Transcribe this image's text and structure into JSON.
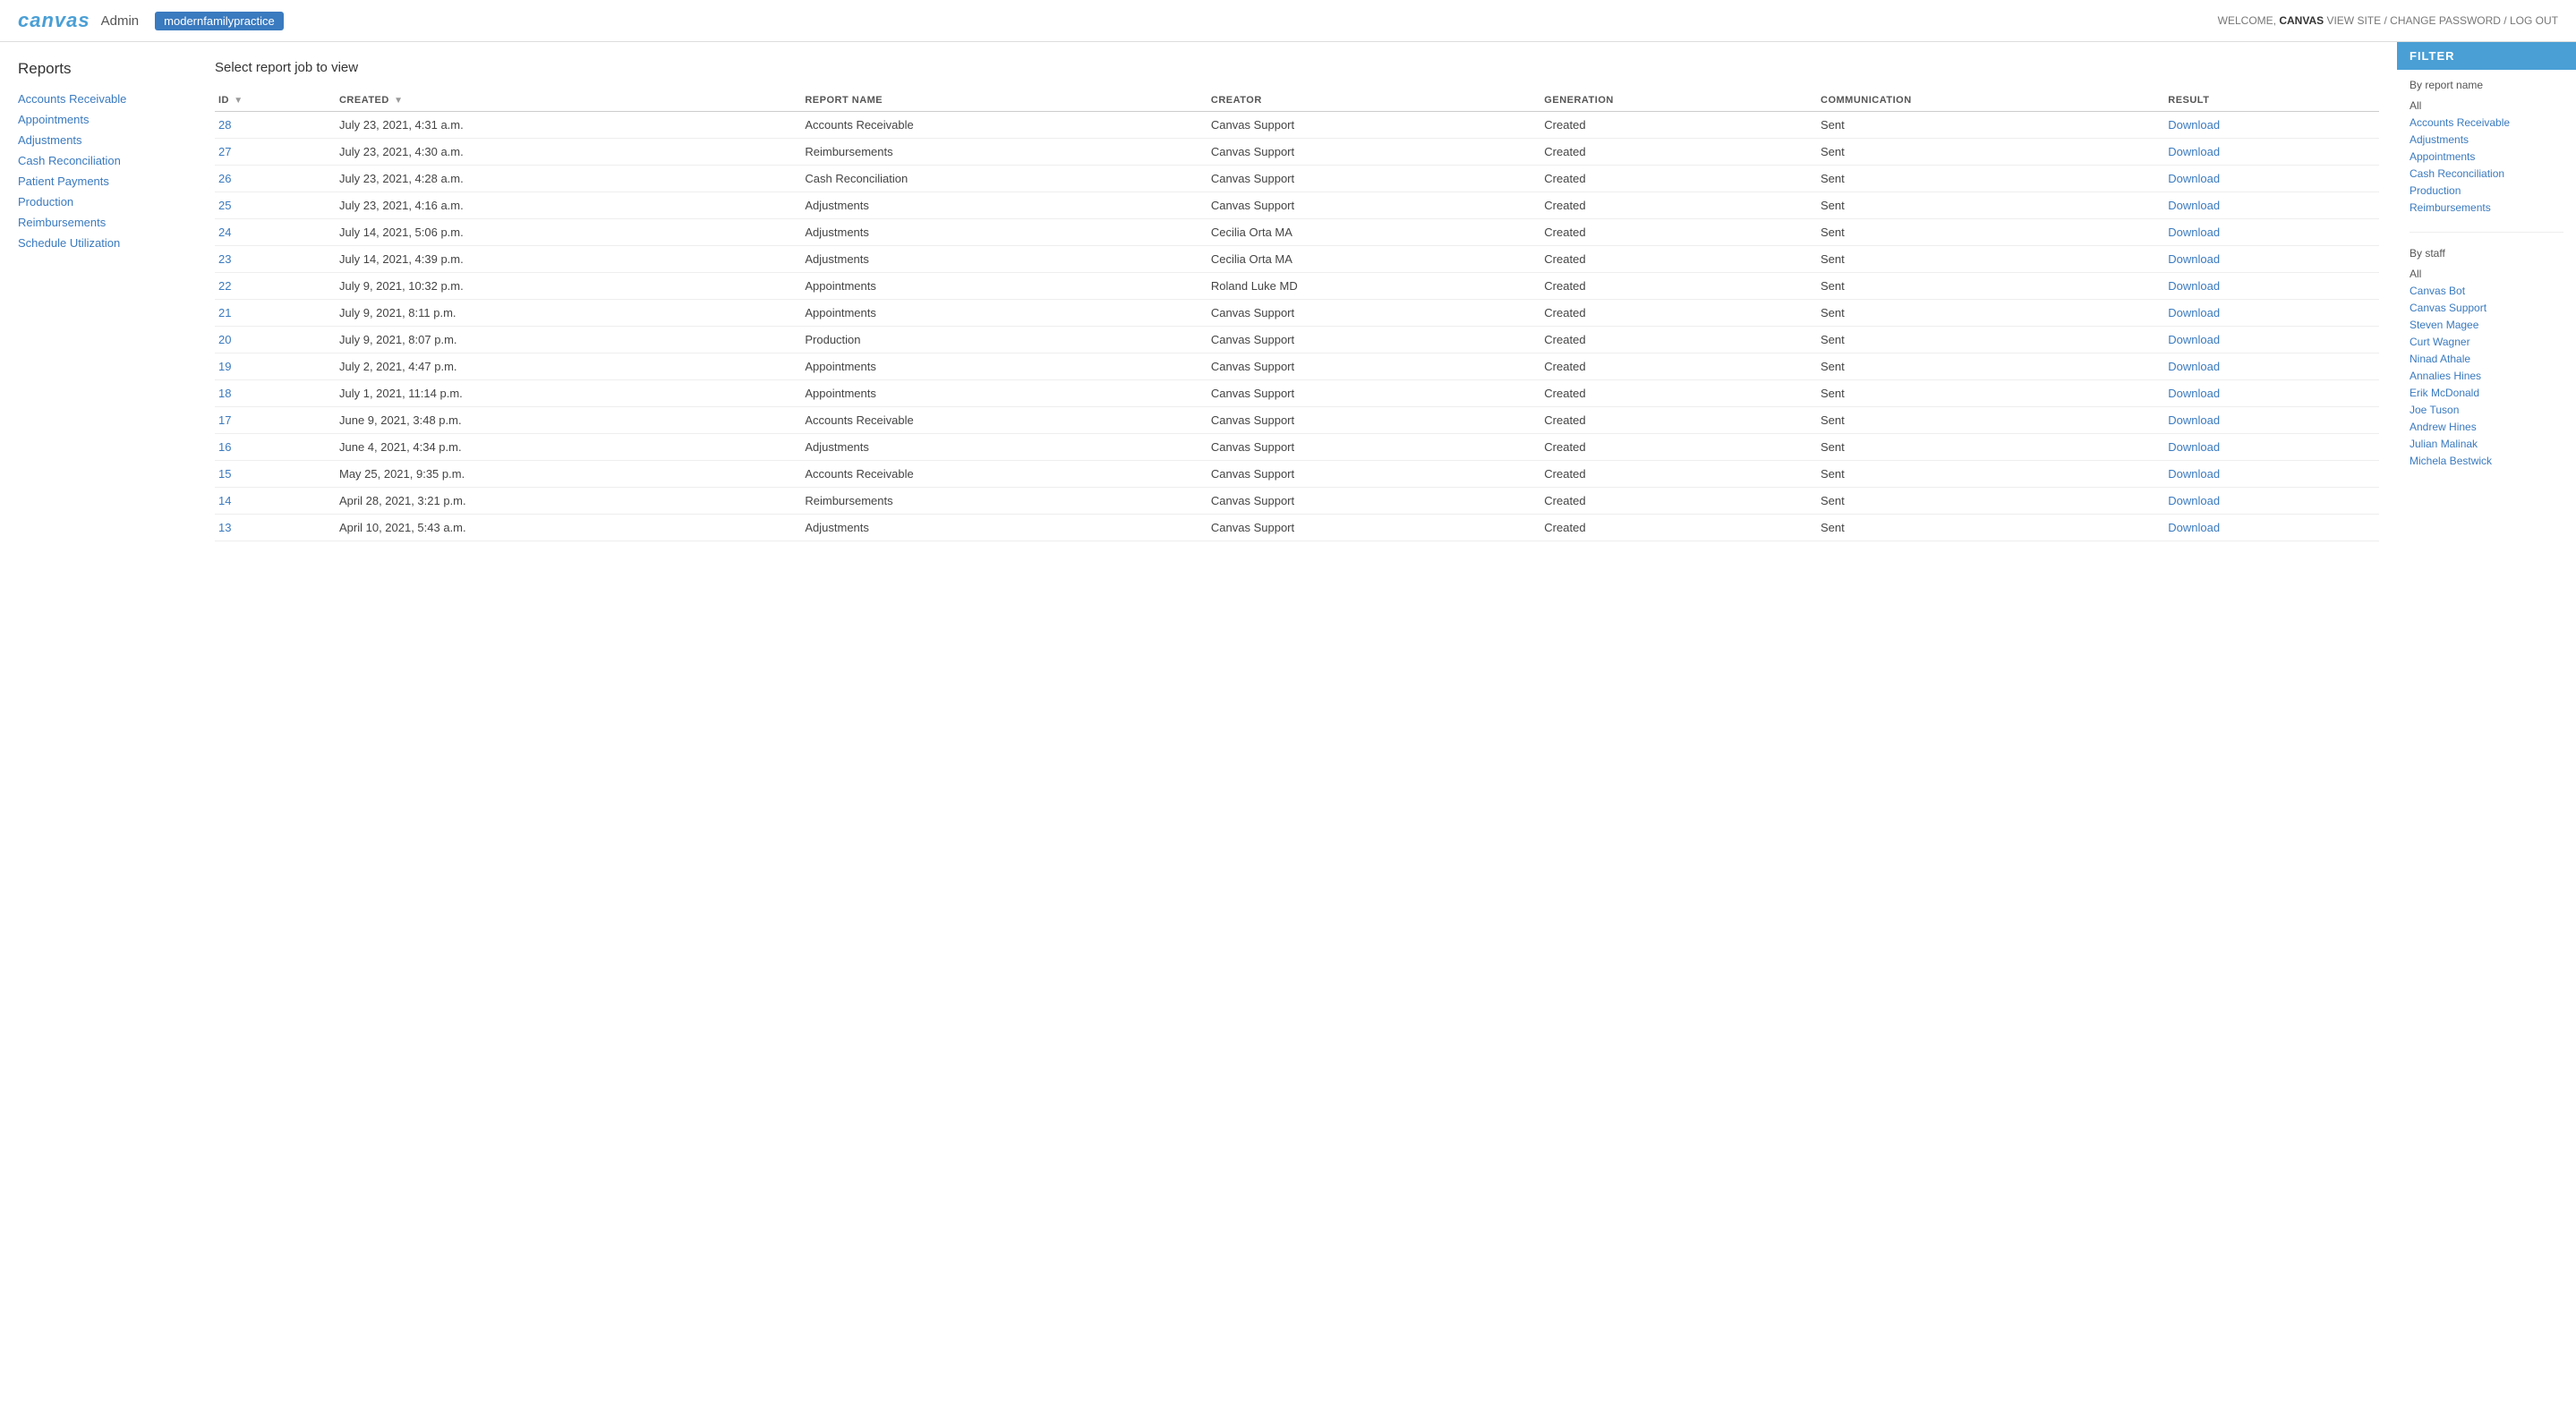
{
  "header": {
    "logo": "canvas",
    "admin_label": "Admin",
    "org_name": "modernfamilypractice",
    "welcome_text": "WELCOME,",
    "username": "CANVAS",
    "view_site": "VIEW SITE",
    "change_password": "CHANGE PASSWORD",
    "log_out": "LOG OUT"
  },
  "sidebar": {
    "title": "Reports",
    "nav_items": [
      {
        "label": "Accounts Receivable",
        "href": "#"
      },
      {
        "label": "Appointments",
        "href": "#"
      },
      {
        "label": "Adjustments",
        "href": "#"
      },
      {
        "label": "Cash Reconciliation",
        "href": "#"
      },
      {
        "label": "Patient Payments",
        "href": "#"
      },
      {
        "label": "Production",
        "href": "#"
      },
      {
        "label": "Reimbursements",
        "href": "#"
      },
      {
        "label": "Schedule Utilization",
        "href": "#"
      }
    ]
  },
  "main": {
    "section_title": "Select report job to view",
    "table": {
      "columns": [
        {
          "key": "id",
          "label": "ID",
          "sortable": true
        },
        {
          "key": "created",
          "label": "CREATED",
          "sortable": true
        },
        {
          "key": "report_name",
          "label": "REPORT NAME",
          "sortable": false
        },
        {
          "key": "creator",
          "label": "CREATOR",
          "sortable": false
        },
        {
          "key": "generation",
          "label": "GENERATION",
          "sortable": false
        },
        {
          "key": "communication",
          "label": "COMMUNICATION",
          "sortable": false
        },
        {
          "key": "result",
          "label": "RESULT",
          "sortable": false
        }
      ],
      "rows": [
        {
          "id": "28",
          "created": "July 23, 2021, 4:31 a.m.",
          "report_name": "Accounts Receivable",
          "creator": "Canvas Support",
          "generation": "Created",
          "communication": "Sent",
          "result": "Download"
        },
        {
          "id": "27",
          "created": "July 23, 2021, 4:30 a.m.",
          "report_name": "Reimbursements",
          "creator": "Canvas Support",
          "generation": "Created",
          "communication": "Sent",
          "result": "Download"
        },
        {
          "id": "26",
          "created": "July 23, 2021, 4:28 a.m.",
          "report_name": "Cash Reconciliation",
          "creator": "Canvas Support",
          "generation": "Created",
          "communication": "Sent",
          "result": "Download"
        },
        {
          "id": "25",
          "created": "July 23, 2021, 4:16 a.m.",
          "report_name": "Adjustments",
          "creator": "Canvas Support",
          "generation": "Created",
          "communication": "Sent",
          "result": "Download"
        },
        {
          "id": "24",
          "created": "July 14, 2021, 5:06 p.m.",
          "report_name": "Adjustments",
          "creator": "Cecilia Orta MA",
          "generation": "Created",
          "communication": "Sent",
          "result": "Download"
        },
        {
          "id": "23",
          "created": "July 14, 2021, 4:39 p.m.",
          "report_name": "Adjustments",
          "creator": "Cecilia Orta MA",
          "generation": "Created",
          "communication": "Sent",
          "result": "Download"
        },
        {
          "id": "22",
          "created": "July 9, 2021, 10:32 p.m.",
          "report_name": "Appointments",
          "creator": "Roland Luke MD",
          "generation": "Created",
          "communication": "Sent",
          "result": "Download"
        },
        {
          "id": "21",
          "created": "July 9, 2021, 8:11 p.m.",
          "report_name": "Appointments",
          "creator": "Canvas Support",
          "generation": "Created",
          "communication": "Sent",
          "result": "Download"
        },
        {
          "id": "20",
          "created": "July 9, 2021, 8:07 p.m.",
          "report_name": "Production",
          "creator": "Canvas Support",
          "generation": "Created",
          "communication": "Sent",
          "result": "Download"
        },
        {
          "id": "19",
          "created": "July 2, 2021, 4:47 p.m.",
          "report_name": "Appointments",
          "creator": "Canvas Support",
          "generation": "Created",
          "communication": "Sent",
          "result": "Download"
        },
        {
          "id": "18",
          "created": "July 1, 2021, 11:14 p.m.",
          "report_name": "Appointments",
          "creator": "Canvas Support",
          "generation": "Created",
          "communication": "Sent",
          "result": "Download"
        },
        {
          "id": "17",
          "created": "June 9, 2021, 3:48 p.m.",
          "report_name": "Accounts Receivable",
          "creator": "Canvas Support",
          "generation": "Created",
          "communication": "Sent",
          "result": "Download"
        },
        {
          "id": "16",
          "created": "June 4, 2021, 4:34 p.m.",
          "report_name": "Adjustments",
          "creator": "Canvas Support",
          "generation": "Created",
          "communication": "Sent",
          "result": "Download"
        },
        {
          "id": "15",
          "created": "May 25, 2021, 9:35 p.m.",
          "report_name": "Accounts Receivable",
          "creator": "Canvas Support",
          "generation": "Created",
          "communication": "Sent",
          "result": "Download"
        },
        {
          "id": "14",
          "created": "April 28, 2021, 3:21 p.m.",
          "report_name": "Reimbursements",
          "creator": "Canvas Support",
          "generation": "Created",
          "communication": "Sent",
          "result": "Download"
        },
        {
          "id": "13",
          "created": "April 10, 2021, 5:43 a.m.",
          "report_name": "Adjustments",
          "creator": "Canvas Support",
          "generation": "Created",
          "communication": "Sent",
          "result": "Download"
        }
      ]
    }
  },
  "filter": {
    "header": "FILTER",
    "by_report_name_title": "By report name",
    "report_name_items": [
      {
        "label": "All",
        "active": true
      },
      {
        "label": "Accounts Receivable",
        "active": false
      },
      {
        "label": "Adjustments",
        "active": false
      },
      {
        "label": "Appointments",
        "active": false
      },
      {
        "label": "Cash Reconciliation",
        "active": false
      },
      {
        "label": "Production",
        "active": false
      },
      {
        "label": "Reimbursements",
        "active": false
      }
    ],
    "by_staff_title": "By staff",
    "staff_items": [
      {
        "label": "All",
        "active": true
      },
      {
        "label": "Canvas Bot",
        "active": false
      },
      {
        "label": "Canvas Support",
        "active": false
      },
      {
        "label": "Steven Magee",
        "active": false
      },
      {
        "label": "Curt Wagner",
        "active": false
      },
      {
        "label": "Ninad Athale",
        "active": false
      },
      {
        "label": "Annalies Hines",
        "active": false
      },
      {
        "label": "Erik McDonald",
        "active": false
      },
      {
        "label": "Joe Tuson",
        "active": false
      },
      {
        "label": "Andrew Hines",
        "active": false
      },
      {
        "label": "Julian Malinak",
        "active": false
      },
      {
        "label": "Michela Bestwick",
        "active": false
      }
    ]
  }
}
